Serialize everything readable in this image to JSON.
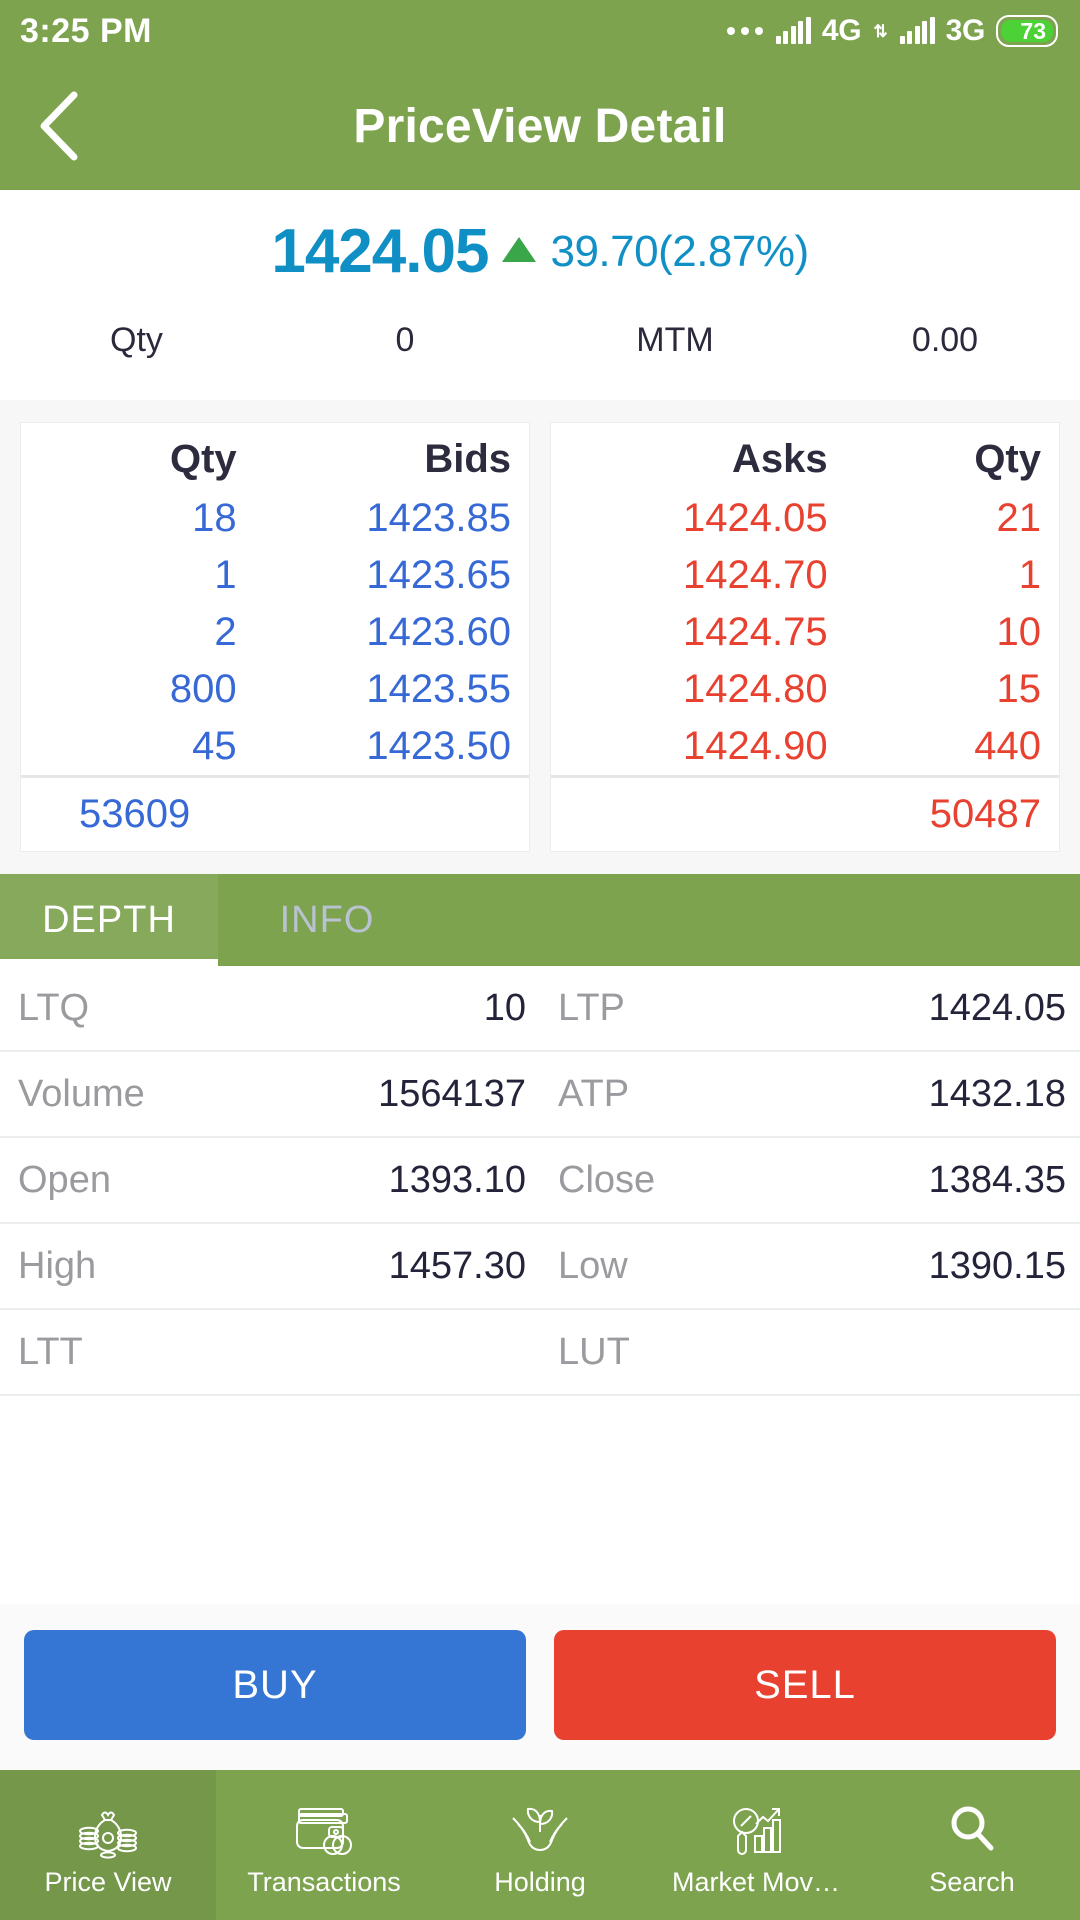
{
  "status_bar": {
    "time": "3:25 PM",
    "network_primary": "4G",
    "network_secondary": "3G",
    "battery_level": "73"
  },
  "app_bar": {
    "title": "PriceView Detail",
    "back_label": "‹"
  },
  "price": {
    "ltp": "1424.05",
    "change": "39.70(2.87%)",
    "direction": "up",
    "qty_label": "Qty",
    "qty_value": "0",
    "mtm_label": "MTM",
    "mtm_value": "0.00"
  },
  "depth": {
    "bid_headers": [
      "Qty",
      "Bids"
    ],
    "ask_headers": [
      "Asks",
      "Qty"
    ],
    "bids": [
      {
        "qty": "18",
        "price": "1423.85"
      },
      {
        "qty": "1",
        "price": "1423.65"
      },
      {
        "qty": "2",
        "price": "1423.60"
      },
      {
        "qty": "800",
        "price": "1423.55"
      },
      {
        "qty": "45",
        "price": "1423.50"
      }
    ],
    "asks": [
      {
        "price": "1424.05",
        "qty": "21"
      },
      {
        "price": "1424.70",
        "qty": "1"
      },
      {
        "price": "1424.75",
        "qty": "10"
      },
      {
        "price": "1424.80",
        "qty": "15"
      },
      {
        "price": "1424.90",
        "qty": "440"
      }
    ],
    "bid_total": "53609",
    "ask_total": "50487"
  },
  "tabs": [
    {
      "label": "DEPTH",
      "active": true
    },
    {
      "label": "INFO",
      "active": false
    }
  ],
  "info_rows": [
    {
      "l_label": "LTQ",
      "l_value": "10",
      "r_label": "LTP",
      "r_value": "1424.05"
    },
    {
      "l_label": "Volume",
      "l_value": "1564137",
      "r_label": "ATP",
      "r_value": "1432.18"
    },
    {
      "l_label": "Open",
      "l_value": "1393.10",
      "r_label": "Close",
      "r_value": "1384.35"
    },
    {
      "l_label": "High",
      "l_value": "1457.30",
      "r_label": "Low",
      "r_value": "1390.15"
    },
    {
      "l_label": "LTT",
      "l_value": "",
      "r_label": "LUT",
      "r_value": ""
    }
  ],
  "actions": {
    "buy_label": "BUY",
    "sell_label": "SELL"
  },
  "bottom_nav": [
    {
      "label": "Price View",
      "icon": "money-bag-icon",
      "active": true
    },
    {
      "label": "Transactions",
      "icon": "wallet-icon",
      "active": false
    },
    {
      "label": "Holding",
      "icon": "hands-plant-icon",
      "active": false
    },
    {
      "label": "Market Mov…",
      "icon": "market-chart-icon",
      "active": false
    },
    {
      "label": "Search",
      "icon": "search-icon",
      "active": false
    }
  ],
  "colors": {
    "brand_green": "#7da34f",
    "bid_blue": "#3769d6",
    "ask_red": "#e8412f",
    "price_blue": "#0f8fc4",
    "up_green": "#3aa64a",
    "buy_blue": "#3575d3",
    "sell_red": "#e8412f"
  }
}
